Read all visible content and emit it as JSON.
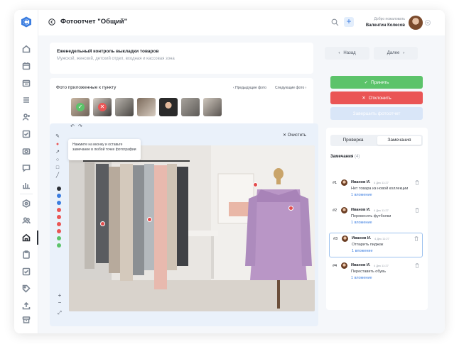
{
  "header": {
    "title": "Фотоотчет \"Общий\"",
    "welcome": "Добро пожаловать",
    "user_name": "Валентин Колесов"
  },
  "task": {
    "title": "Еженедельный контроль выкладки товаров",
    "subtitle": "Мужской, женский, детский отдел, входная и кассовая зона"
  },
  "nav": {
    "back_label": "Назад",
    "next_label": "Далее"
  },
  "photos": {
    "label": "Фото приложенные к пункту",
    "prev_label": "Предыдущие фото",
    "next_label": "Следующие фото",
    "thumbs": [
      {
        "status": "accepted",
        "mark": "✓"
      },
      {
        "status": "rejected",
        "mark": "✕"
      },
      {
        "status": "none"
      },
      {
        "status": "none"
      },
      {
        "status": "none"
      },
      {
        "status": "none"
      },
      {
        "status": "none"
      }
    ]
  },
  "editor": {
    "tooltip": "Нажмите на иконку и оставьте замечание в любой точке фотографии",
    "clear_label": "Очистить",
    "colors": [
      "#2b2f36",
      "#3b7de0",
      "#3b7de0",
      "#ea5555",
      "#ea5555",
      "#ea5555",
      "#ea5555",
      "#5cc36a",
      "#5cc36a"
    ]
  },
  "actions": {
    "accept_label": "Принять",
    "reject_label": "Отклонить",
    "finish_label": "Завершить фотоотчет"
  },
  "tabs": {
    "review": "Проверка",
    "remarks": "Замечания"
  },
  "remarks": {
    "heading": "Замечания",
    "count": "(4)",
    "items": [
      {
        "num": "#1",
        "name": "Иванов И.",
        "time": "4 Дек 11:27",
        "text": "Нет товара из новой коллекции",
        "link": "1 вложение"
      },
      {
        "num": "#2",
        "name": "Иванов И.",
        "time": "4 Дек 11:27",
        "text": "Перевесить футболки",
        "link": "1 вложение"
      },
      {
        "num": "#3",
        "name": "Иванов И.",
        "time": "4 Дек 11:27",
        "text": "Отпарить пиджак",
        "link": "1 вложение"
      },
      {
        "num": "#4",
        "name": "Иванов И.",
        "time": "4 Дек 11:27",
        "text": "Переставить обувь",
        "link": "1 вложение"
      }
    ]
  },
  "colors": {
    "accent": "#3b7de0",
    "success": "#5cc36a",
    "danger": "#ea5555"
  }
}
